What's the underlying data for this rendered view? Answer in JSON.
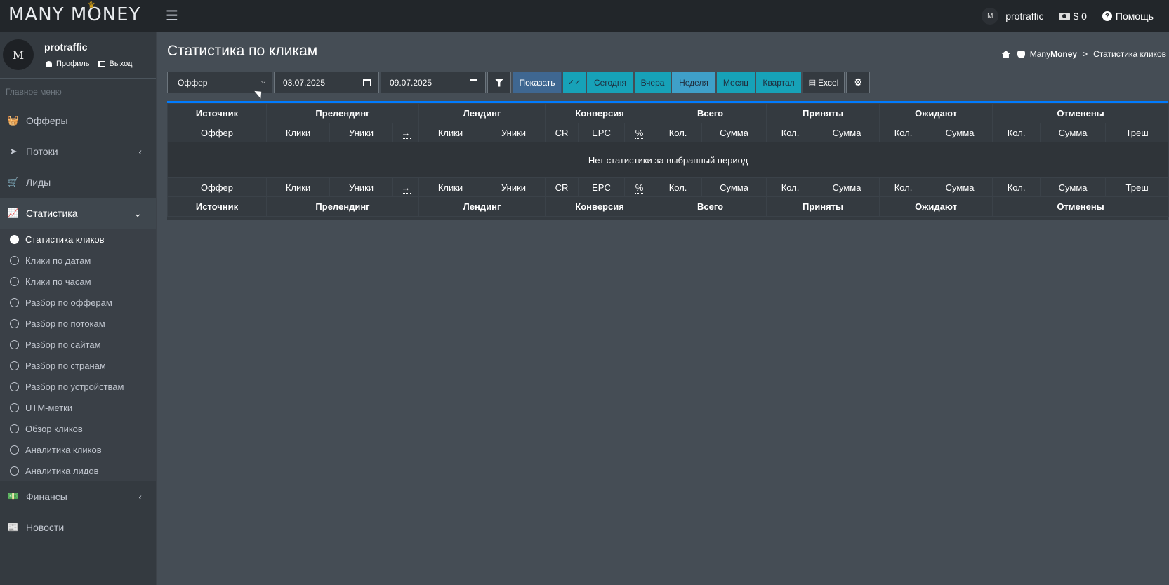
{
  "app": {
    "logo_text": "MANY MONEY",
    "logo_crown": "♛"
  },
  "topbar": {
    "username": "protraffic",
    "avatar_text": "M",
    "balance": "$ 0",
    "help_label": "Помощь"
  },
  "user_panel": {
    "name": "protraffic",
    "avatar_text": "M",
    "profile_label": "Профиль",
    "logout_label": "Выход"
  },
  "sidebar": {
    "header": "Главное меню",
    "items": [
      {
        "label": "Офферы"
      },
      {
        "label": "Потоки"
      },
      {
        "label": "Лиды"
      },
      {
        "label": "Статистика"
      },
      {
        "label": "Финансы"
      },
      {
        "label": "Новости"
      }
    ],
    "stats_sub": [
      {
        "label": "Статистика кликов"
      },
      {
        "label": "Клики по датам"
      },
      {
        "label": "Клики по часам"
      },
      {
        "label": "Разбор по офферам"
      },
      {
        "label": "Разбор по потокам"
      },
      {
        "label": "Разбор по сайтам"
      },
      {
        "label": "Разбор по странам"
      },
      {
        "label": "Разбор по устройствам"
      },
      {
        "label": "UTM-метки"
      },
      {
        "label": "Обзор кликов"
      },
      {
        "label": "Аналитика кликов"
      },
      {
        "label": "Аналитика лидов"
      }
    ]
  },
  "page": {
    "title": "Статистика по кликам",
    "breadcrumb_root": "Many",
    "breadcrumb_root_bold": "Money",
    "breadcrumb_sep": ">",
    "breadcrumb_current": "Статистика кликов"
  },
  "toolbar": {
    "select_value": "Оффер",
    "date_from": "03.07.2025",
    "date_to": "09.07.2025",
    "show_label": "Показать",
    "check_label": "✓✓",
    "today_label": "Сегодня",
    "yesterday_label": "Вчера",
    "week_label": "Неделя",
    "month_label": "Месяц",
    "quarter_label": "Квартал",
    "excel_label": "Excel"
  },
  "table": {
    "group_headers": [
      "Источник",
      "Прелендинг",
      "Лендинг",
      "Конверсия",
      "Всего",
      "Приняты",
      "Ожидают",
      "Отменены"
    ],
    "sub_headers": [
      "Оффер",
      "Клики",
      "Уники",
      "→",
      "Клики",
      "Уники",
      "CR",
      "EPC",
      "%",
      "Кол.",
      "Сумма",
      "Кол.",
      "Сумма",
      "Кол.",
      "Сумма",
      "Кол.",
      "Сумма",
      "Треш"
    ],
    "empty_message": "Нет статистики за выбранный период"
  }
}
